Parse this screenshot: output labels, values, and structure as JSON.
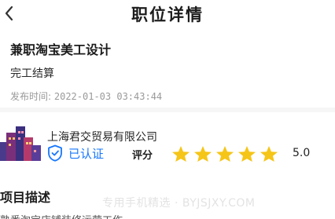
{
  "header": {
    "back_icon": "chevron-left-icon",
    "title": "职位详情"
  },
  "job": {
    "title": "兼职淘宝美工设计",
    "settlement": "完工结算",
    "publish_label": "发布时间:",
    "publish_time": "2022-01-03 03:43:44"
  },
  "company": {
    "logo_icon": "city-buildings-icon",
    "name": "上海君交贸易有限公司",
    "verified_icon": "shield-icon",
    "verified_label": "已认证",
    "rating_label": "评分",
    "rating_stars": 5,
    "rating_max": 5,
    "score": "5.0",
    "colors": {
      "verified": "#1677ff",
      "star": "#f5c518"
    }
  },
  "section": {
    "title": "项目描述",
    "watermark": "专用手机精选 · BYJSJXY.COM",
    "desc_first_line": "熟悉淘宝店铺装修运营工作，能够适合上班"
  }
}
